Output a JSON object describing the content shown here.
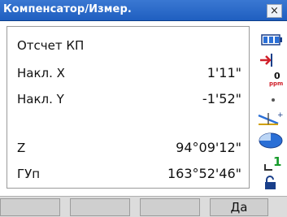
{
  "window": {
    "title": "Компенсатор/Измер.",
    "close_label": "×"
  },
  "fields": [
    {
      "label": "Отсчет КП",
      "value": ""
    },
    {
      "label": "Накл. X",
      "value": "1'11\""
    },
    {
      "label": "Накл. Y",
      "value": "-1'52\""
    },
    {
      "label": "Z",
      "value": "94°09'12\""
    },
    {
      "label": "ГУп",
      "value": "163°52'46\""
    }
  ],
  "status": {
    "ppm_value": "0",
    "ppm_unit": "ppm",
    "level_value": "1",
    "battery_color": "#2a6fd6"
  },
  "softkeys": [
    "",
    "",
    "",
    "Да"
  ]
}
